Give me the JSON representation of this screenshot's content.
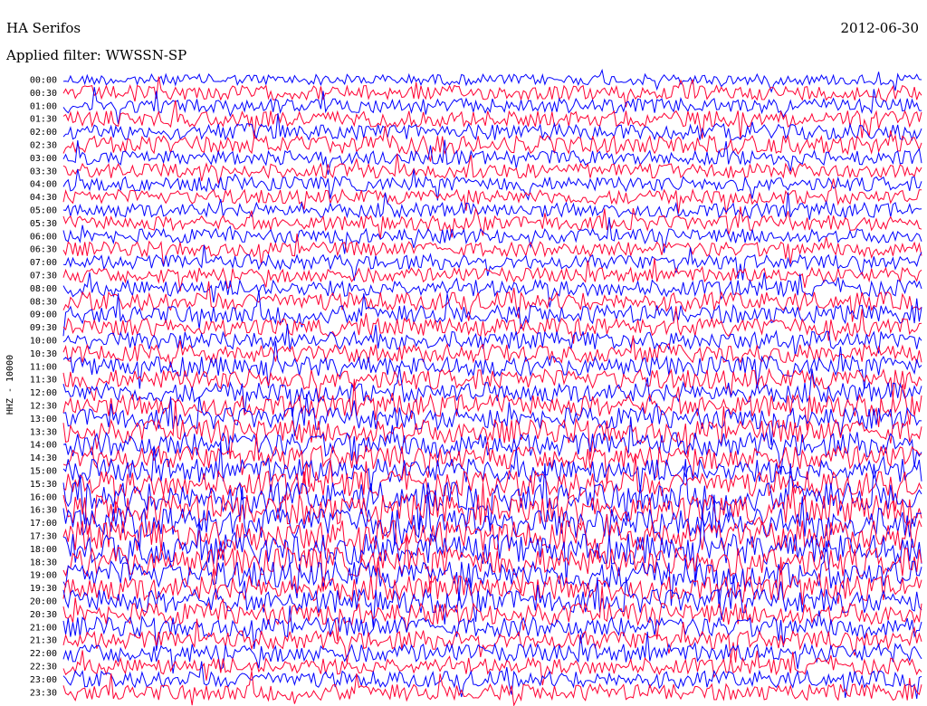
{
  "station_title": "HA Serifos",
  "date": "2012-06-30",
  "filter_label": "Applied filter: WWSSN-SP",
  "chart_data": {
    "type": "line",
    "plot": "helicorder",
    "ylabel": "HHZ - 10000",
    "row_labels": [
      "00:00",
      "00:30",
      "01:00",
      "01:30",
      "02:00",
      "02:30",
      "03:00",
      "03:30",
      "04:00",
      "04:30",
      "05:00",
      "05:30",
      "06:00",
      "06:30",
      "07:00",
      "07:30",
      "08:00",
      "08:30",
      "09:00",
      "09:30",
      "10:00",
      "10:30",
      "11:00",
      "11:30",
      "12:00",
      "12:30",
      "13:00",
      "13:30",
      "14:00",
      "14:30",
      "15:00",
      "15:30",
      "16:00",
      "16:30",
      "17:00",
      "17:30",
      "18:00",
      "18:30",
      "19:00",
      "19:30",
      "20:00",
      "20:30",
      "21:00",
      "21:30",
      "22:00",
      "22:30",
      "23:00",
      "23:30"
    ],
    "trace_colors": [
      "#0000ff",
      "#ff0033"
    ],
    "noise_amplitude": [
      6,
      8,
      8,
      9,
      9,
      10,
      8,
      8,
      8,
      8,
      8,
      8,
      8,
      8,
      8,
      8,
      9,
      10,
      10,
      10,
      10,
      10,
      11,
      11,
      11,
      12,
      12,
      13,
      13,
      13,
      13,
      14,
      16,
      17,
      17,
      17,
      17,
      16,
      15,
      14,
      13,
      12,
      11,
      10,
      10,
      9,
      9,
      9
    ],
    "grid": false,
    "legend": "none"
  }
}
